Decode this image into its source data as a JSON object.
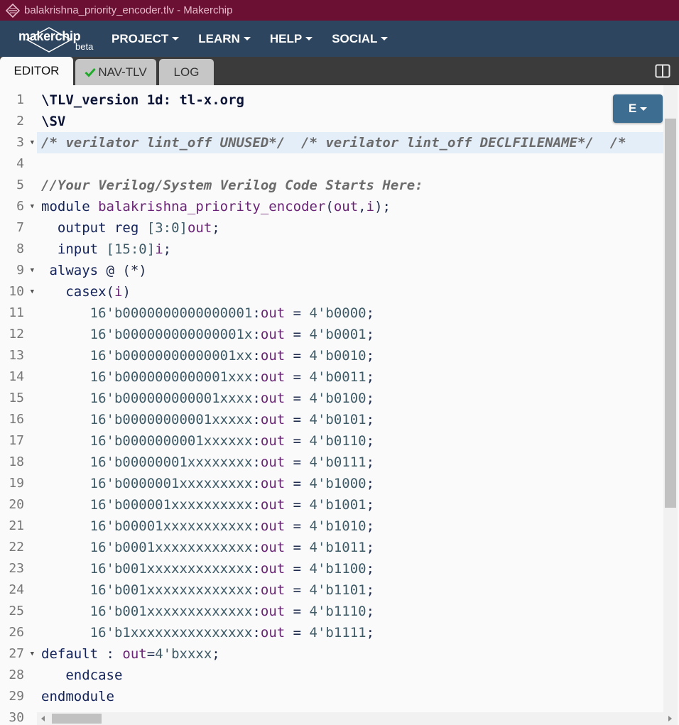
{
  "window": {
    "title": "balakrishna_priority_encoder.tlv - Makerchip"
  },
  "nav": {
    "logo_text": "makerchip",
    "beta": "beta",
    "items": [
      {
        "label": "PROJECT"
      },
      {
        "label": "LEARN"
      },
      {
        "label": "HELP"
      },
      {
        "label": "SOCIAL"
      }
    ]
  },
  "tabs": [
    {
      "label": "EDITOR",
      "active": true
    },
    {
      "label": "NAV-TLV",
      "status_icon": "check-icon"
    },
    {
      "label": "LOG"
    }
  ],
  "editor": {
    "mode_button": "E",
    "active_line": 3,
    "line_numbers": [
      "1",
      "2",
      "3",
      "4",
      "5",
      "6",
      "7",
      "8",
      "9",
      "10",
      "11",
      "12",
      "13",
      "14",
      "15",
      "16",
      "17",
      "18",
      "19",
      "20",
      "21",
      "22",
      "23",
      "24",
      "25",
      "26",
      "27",
      "28",
      "29",
      "30"
    ],
    "foldable_lines": [
      3,
      6,
      9,
      10,
      27
    ],
    "lines": [
      "\\TLV_version 1d: tl-x.org",
      "\\SV",
      "/* verilator lint_off UNUSED*/  /* verilator lint_off DECLFILENAME*/  /*",
      "",
      "//Your Verilog/System Verilog Code Starts Here:",
      "module balakrishna_priority_encoder(out,i);",
      "  output reg [3:0]out;",
      "  input [15:0]i;",
      " always @ (*)",
      "   casex(i)",
      "      16'b0000000000000001:out = 4'b0000;",
      "      16'b000000000000001x:out = 4'b0001;",
      "      16'b00000000000001xx:out = 4'b0010;",
      "      16'b0000000000001xxx:out = 4'b0011;",
      "      16'b000000000001xxxx:out = 4'b0100;",
      "      16'b00000000001xxxxx:out = 4'b0101;",
      "      16'b0000000001xxxxxx:out = 4'b0110;",
      "      16'b00000001xxxxxxxx:out = 4'b0111;",
      "      16'b0000001xxxxxxxxx:out = 4'b1000;",
      "      16'b000001xxxxxxxxxx:out = 4'b1001;",
      "      16'b00001xxxxxxxxxxx:out = 4'b1010;",
      "      16'b0001xxxxxxxxxxxx:out = 4'b1011;",
      "      16'b001xxxxxxxxxxxxx:out = 4'b1100;",
      "      16'b001xxxxxxxxxxxxx:out = 4'b1101;",
      "      16'b001xxxxxxxxxxxxx:out = 4'b1110;",
      "      16'b1xxxxxxxxxxxxxxx:out = 4'b1111;",
      "default : out=4'bxxxx;",
      "   endcase",
      "endmodule",
      ""
    ]
  }
}
